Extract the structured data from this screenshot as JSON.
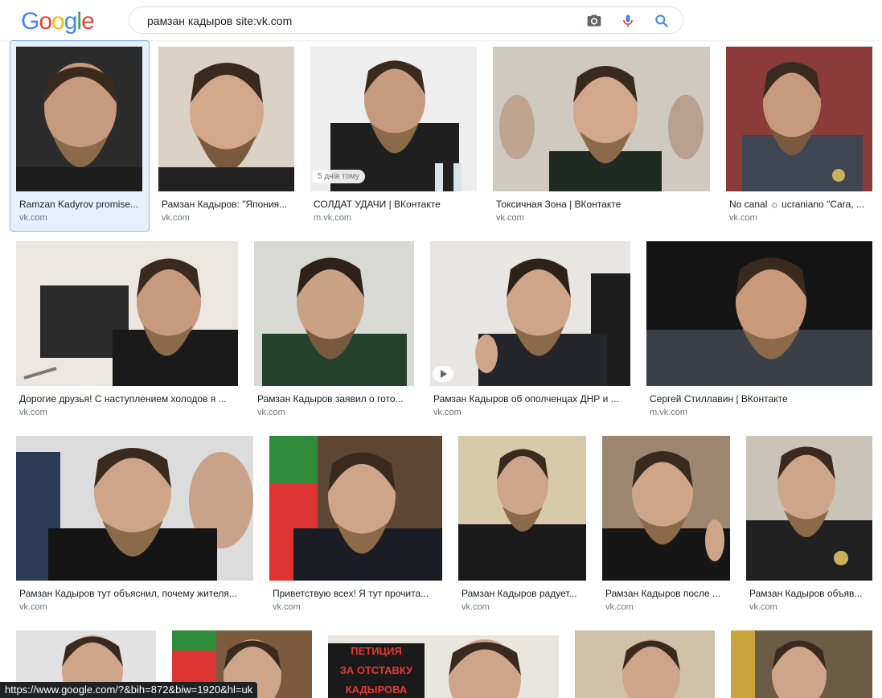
{
  "search": {
    "query": "рамзан кадыров site:vk.com"
  },
  "icons": {
    "camera": "camera-icon",
    "mic": "microphone-icon",
    "search": "search-icon"
  },
  "colors": {
    "logo": [
      "#4285f4",
      "#ea4335",
      "#fbbc05",
      "#4285f4",
      "#34a853",
      "#ea4335"
    ],
    "selected_border": "#8ab4f8",
    "selected_bg": "#e8f0fe"
  },
  "logo_text": "Google",
  "results": [
    {
      "caption": "Ramzan Kadyrov promise...",
      "source": "vk.com"
    },
    {
      "caption": "Рамзан Кадыров: \"Япония...",
      "source": "vk.com"
    },
    {
      "caption": "СОЛДАТ УДАЧИ | ВКонтакте",
      "source": "m.vk.com",
      "badge": "5 днів тому"
    },
    {
      "caption": "Токсичная Зона | ВКонтакте",
      "source": "vk.com"
    },
    {
      "caption": "No canal ☼ ucraniano \"Cara, ...",
      "source": "vk.com"
    },
    {
      "caption": "Дорогие друзья! С наступлением холодов я ...",
      "source": "vk.com"
    },
    {
      "caption": "Рамзан Кадыров заявил о гото...",
      "source": "vk.com"
    },
    {
      "caption": "Рамзан Кадыров об ополченцах ДНР и ...",
      "source": "vk.com"
    },
    {
      "caption": "Сергей Стиллавин | ВКонтакте",
      "source": "m.vk.com"
    },
    {
      "caption": "Рамзан Кадыров тут объяснил, почему жителя...",
      "source": "vk.com"
    },
    {
      "caption": "Приветствую всех! Я тут прочита...",
      "source": "vk.com"
    },
    {
      "caption": "Рамзан Кадыров радует...",
      "source": "vk.com"
    },
    {
      "caption": "Рамзан Кадыров после ...",
      "source": "vk.com"
    },
    {
      "caption": "Рамзан Кадыров объяв...",
      "source": "vk.com"
    }
  ],
  "petition_text": [
    "ПЕТИЦИЯ",
    "ЗА ОТСТАВКУ",
    "КАДЫРОВА"
  ],
  "status_url": "https://www.google.com/?&bih=872&biw=1920&hl=uk"
}
